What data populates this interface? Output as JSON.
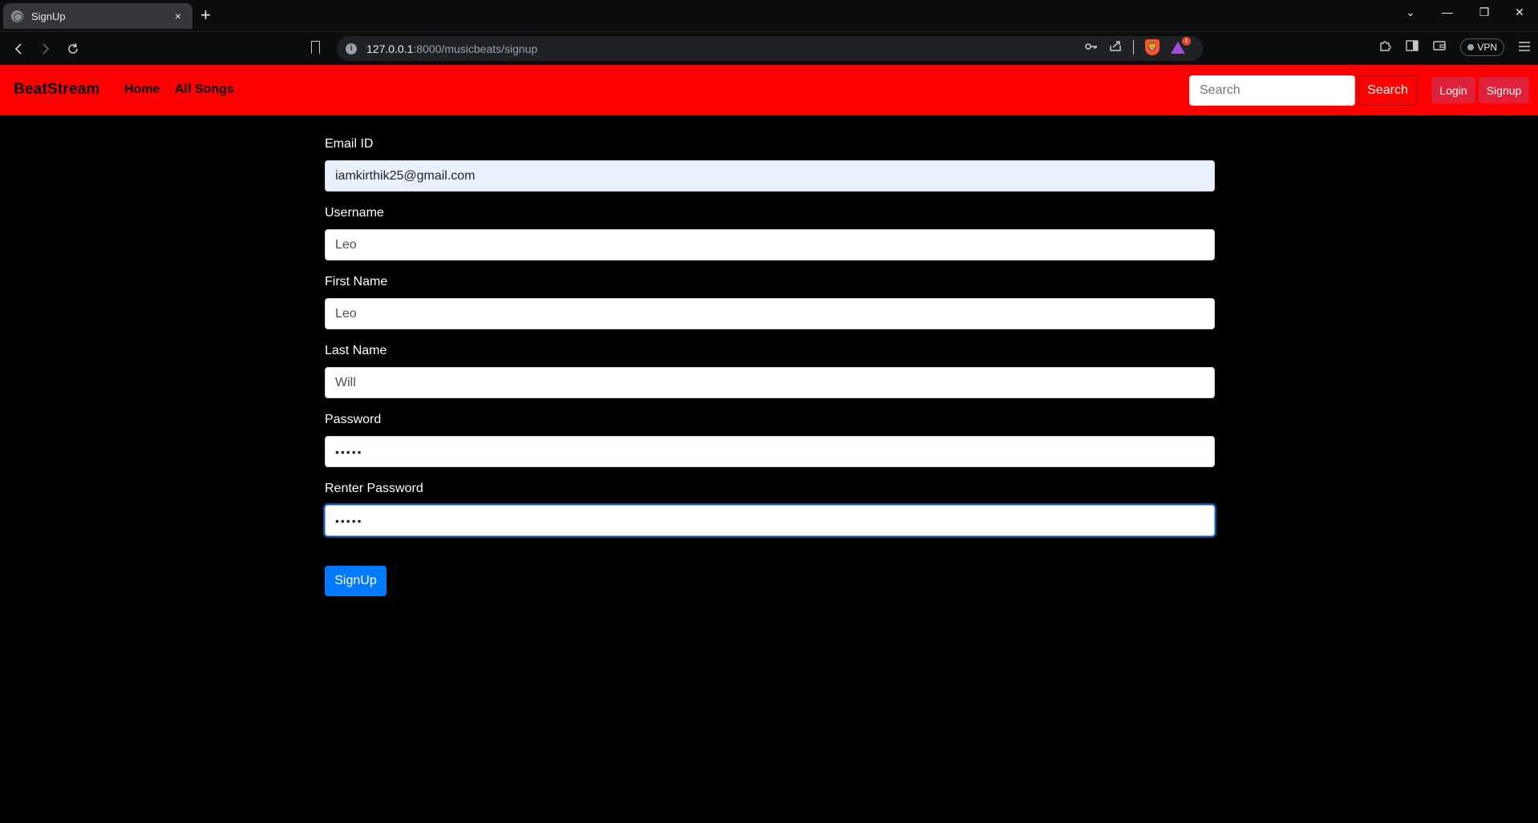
{
  "browser": {
    "tab_title": "SignUp",
    "tab_close": "×",
    "new_tab": "+",
    "url_host": "127.0.0.1",
    "url_path": ":8000/musicbeats/signup",
    "vpn_label": "VPN",
    "rewards_badge": "1",
    "window_controls": {
      "dropdown": "⌄",
      "minimize": "—",
      "restore": "❐",
      "close": "✕"
    },
    "icons": [
      "back-icon",
      "forward-icon",
      "reload-icon",
      "bookmark-icon",
      "site-info-icon",
      "key-icon",
      "share-icon",
      "brave-shields-icon",
      "brave-rewards-icon",
      "extensions-icon",
      "sidebar-icon",
      "wallet-icon",
      "menu-icon"
    ]
  },
  "navbar": {
    "brand": "BeatStream",
    "links": {
      "home": "Home",
      "all_songs": "All Songs"
    },
    "search_placeholder": "Search",
    "search_button": "Search",
    "login_button": "Login",
    "signup_button": "Signup",
    "bg_color": "#ff0000"
  },
  "form": {
    "email": {
      "label": "Email ID",
      "value": "iamkirthik25@gmail.com"
    },
    "username": {
      "label": "Username",
      "value": "Leo"
    },
    "first_name": {
      "label": "First Name",
      "value": "Leo"
    },
    "last_name": {
      "label": "Last Name",
      "value": "Will"
    },
    "password": {
      "label": "Password",
      "value": "•••••"
    },
    "renter_password": {
      "label": "Renter Password",
      "value": "•••••"
    },
    "submit": "SignUp",
    "submit_color": "#007bff"
  }
}
